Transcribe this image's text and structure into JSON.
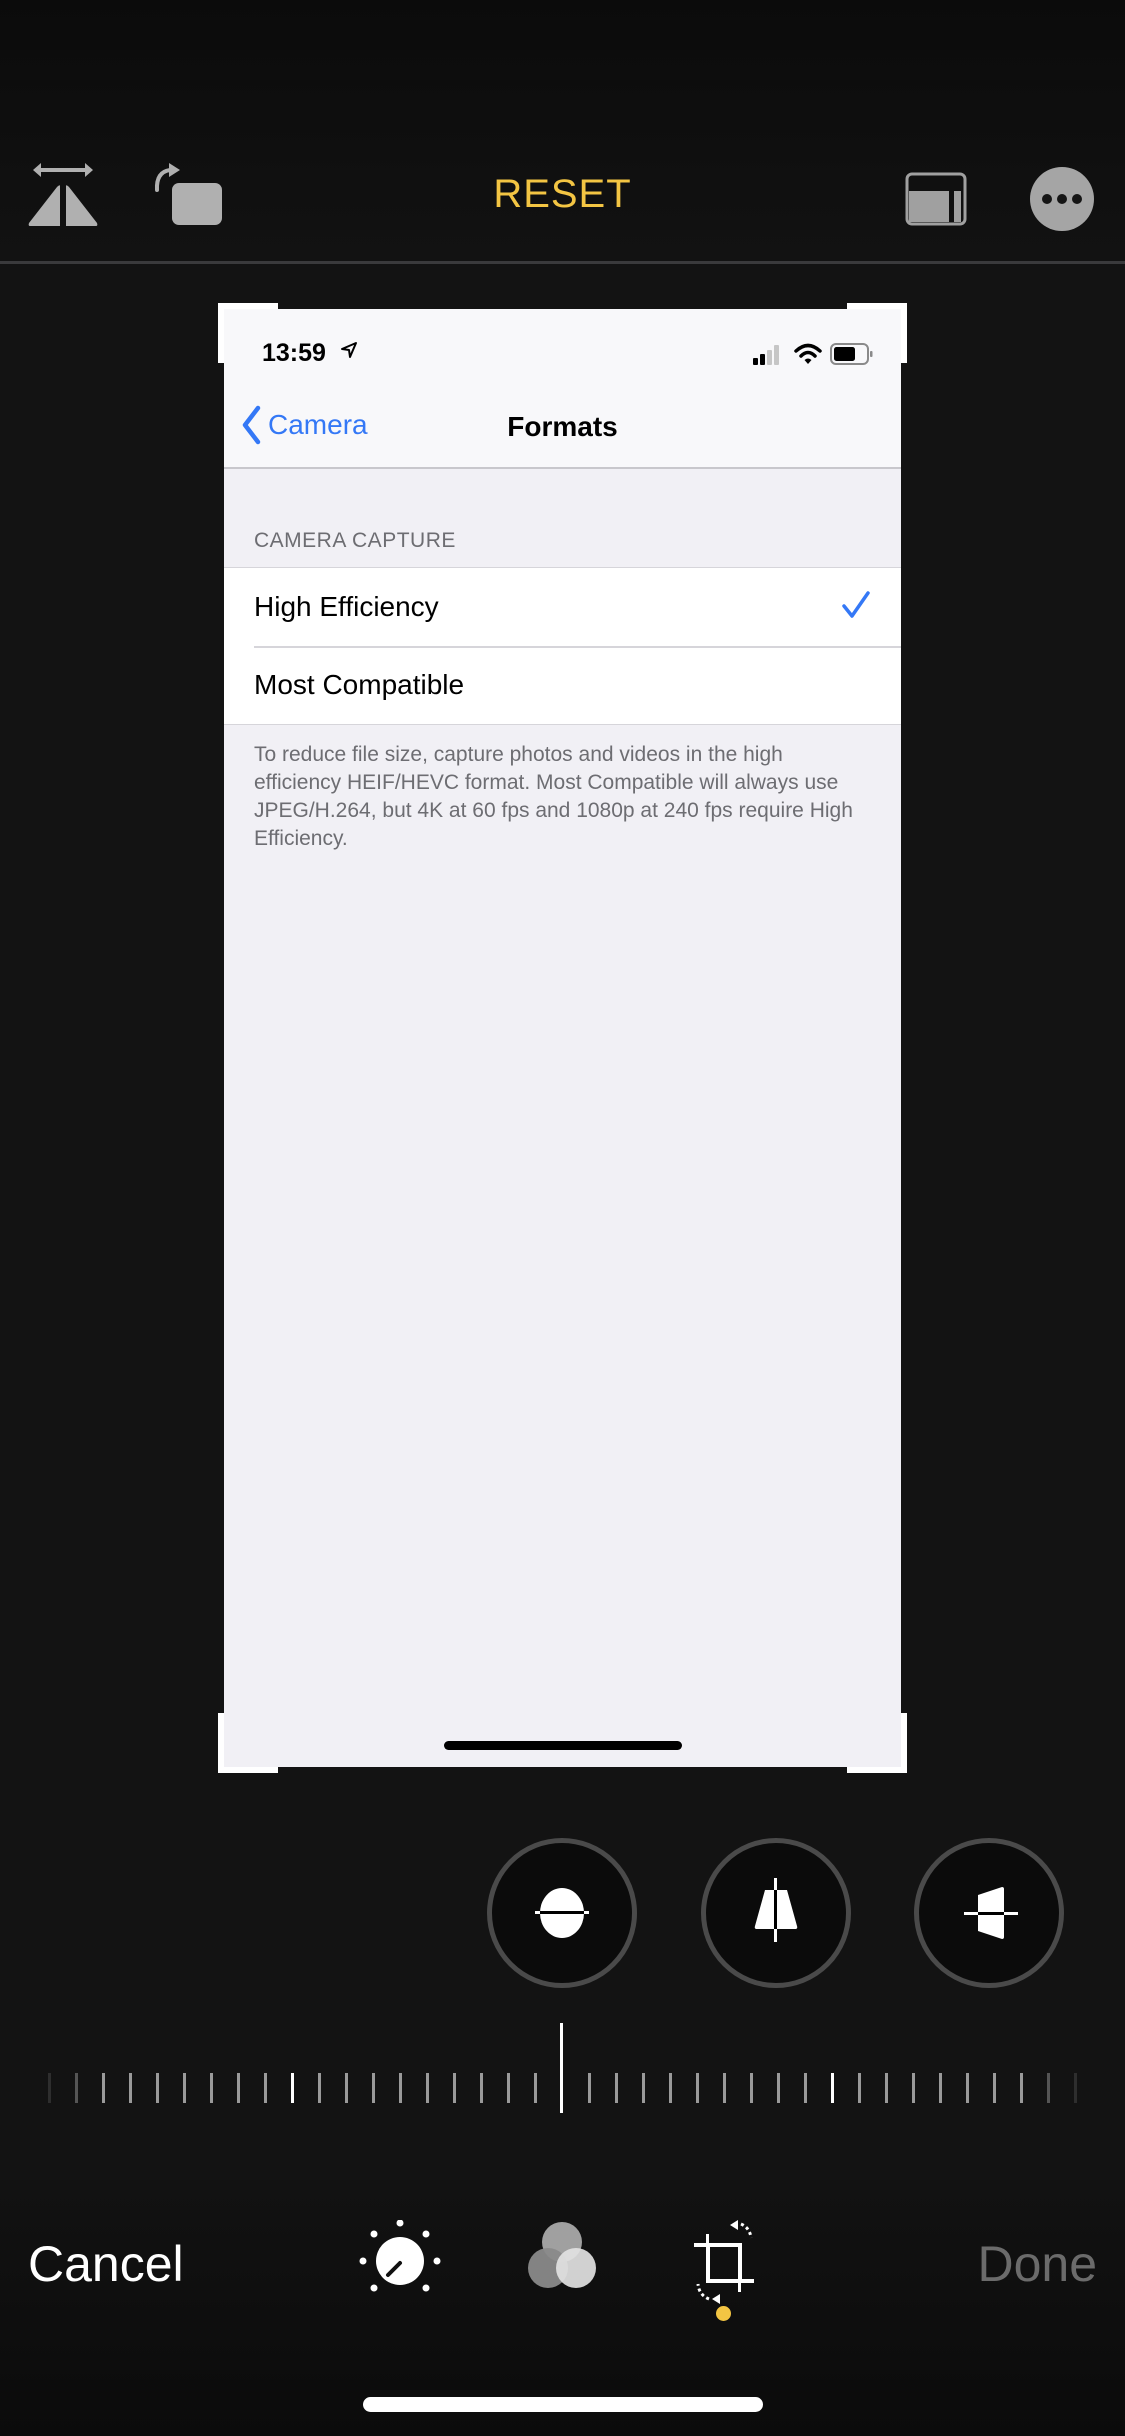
{
  "toolbar": {
    "reset_label": "RESET",
    "icons": [
      "flip-horizontal-icon",
      "rotate-icon",
      "aspect-ratio-icon",
      "more-icon"
    ]
  },
  "screenshot": {
    "status_bar": {
      "time": "13:59",
      "signal_bars_filled": 2,
      "signal_bars_total": 4,
      "battery_level": 0.6
    },
    "nav": {
      "back_label": "Camera",
      "title": "Formats"
    },
    "section_header": "CAMERA CAPTURE",
    "options": [
      {
        "label": "High Efficiency",
        "selected": true
      },
      {
        "label": "Most Compatible",
        "selected": false
      }
    ],
    "footer": "To reduce file size, capture photos and videos in the high efficiency HEIF/HEVC format. Most Compatible will always use JPEG/H.264, but 4K at 60 fps and 1080p at 240 fps require High Efficiency."
  },
  "perspective_tools": [
    {
      "name": "straighten",
      "active": true
    },
    {
      "name": "vertical-perspective",
      "active": false
    },
    {
      "name": "horizontal-perspective",
      "active": false
    }
  ],
  "dial": {
    "value": 0,
    "tick_count": 39,
    "major_tick_every": 10
  },
  "bottom": {
    "cancel_label": "Cancel",
    "done_label": "Done",
    "tools": [
      "adjust",
      "filters",
      "crop"
    ],
    "active_tool": "crop"
  },
  "colors": {
    "accent": "#f3c543",
    "ios_blue": "#3478f6"
  }
}
